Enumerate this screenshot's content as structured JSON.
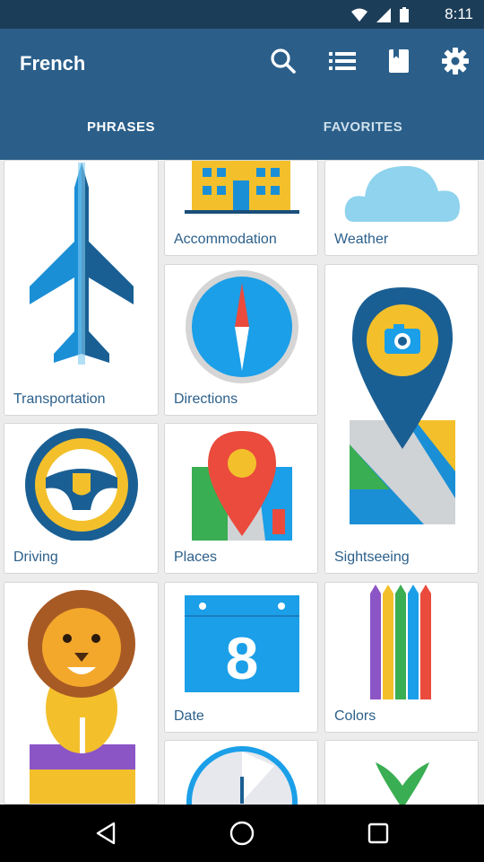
{
  "status_bar": {
    "time": "8:11"
  },
  "app_bar": {
    "title": "French",
    "actions": [
      {
        "icon": "search-icon"
      },
      {
        "icon": "list-icon"
      },
      {
        "icon": "book-icon"
      },
      {
        "icon": "gear-icon"
      }
    ]
  },
  "tabs": [
    {
      "label": "PHRASES",
      "active": true
    },
    {
      "label": "FAVORITES",
      "active": false
    }
  ],
  "categories": [
    {
      "label": "",
      "icon": "airplane-icon"
    },
    {
      "label": "Accommodation",
      "icon": "hotel-building-icon"
    },
    {
      "label": "Weather",
      "icon": "cloud-icon"
    },
    {
      "label": "Transportation",
      "icon": "airplane-icon"
    },
    {
      "label": "Directions",
      "icon": "compass-icon"
    },
    {
      "label": "Sightseeing",
      "icon": "camera-map-pin-icon"
    },
    {
      "label": "Driving",
      "icon": "steering-wheel-icon"
    },
    {
      "label": "Places",
      "icon": "map-pin-icon"
    },
    {
      "label": "Date",
      "icon": "calendar-icon"
    },
    {
      "label": "Colors",
      "icon": "colored-pencils-icon"
    },
    {
      "label": "",
      "icon": "lion-icon"
    },
    {
      "label": "",
      "icon": "clock-icon"
    },
    {
      "label": "",
      "icon": "plant-icon"
    }
  ],
  "calendar_day": "8",
  "colors": {
    "app_bar": "#2b5f8a",
    "status_bar": "#1c3d58",
    "label_text": "#2b5f8a",
    "background": "#ececec"
  },
  "nav_bar": {
    "buttons": [
      {
        "icon": "back-icon"
      },
      {
        "icon": "home-icon"
      },
      {
        "icon": "recents-icon"
      }
    ]
  }
}
